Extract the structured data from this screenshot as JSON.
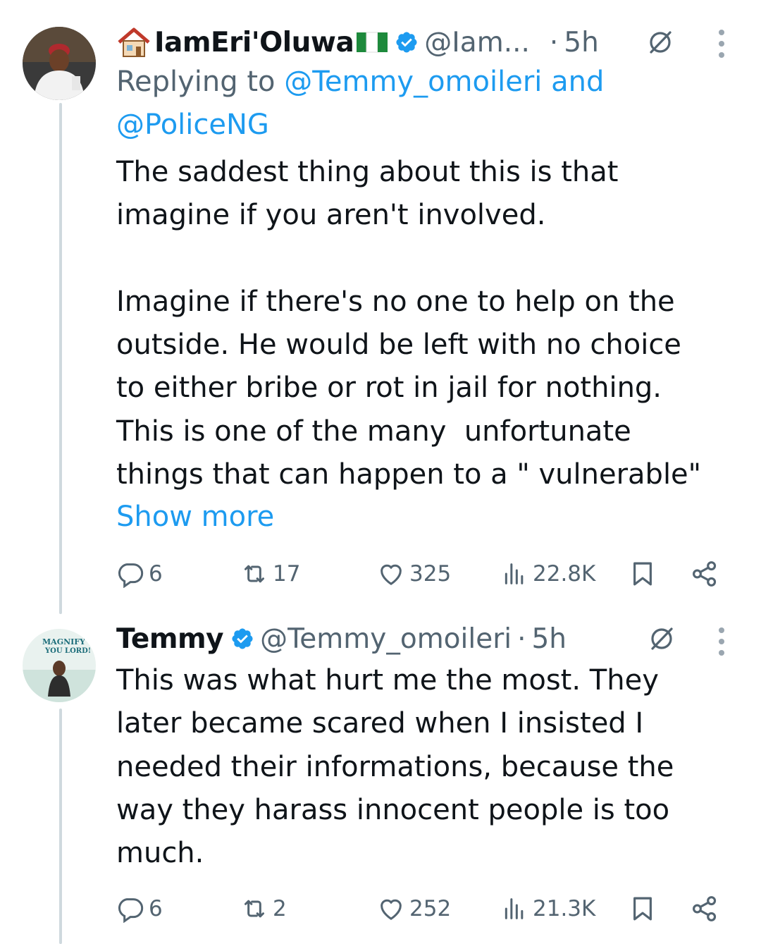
{
  "tweets": [
    {
      "emoji_prefix": "🏚",
      "name": "IamEri'Oluwa",
      "flag": "Nigeria flag",
      "handle": "@Iam...",
      "dot": "·",
      "time": "5h",
      "reply_prefix": "Replying to ",
      "reply_user1": "@Temmy_omoileri",
      "reply_and": " and",
      "reply_user2": "@PoliceNG",
      "text": "The saddest thing about this is that\nimagine if you aren't involved.\n\nImagine if there's no one to help on the\noutside. He would be left with no choice\nto either bribe or rot in jail for nothing.\nThis is one of the many  unfortunate\nthings that can happen to a \" vulnerable\"",
      "show_more": "Show more",
      "replies": "6",
      "reposts": "17",
      "likes": "325",
      "views": "22.8K"
    },
    {
      "name": "Temmy",
      "handle": "@Temmy_omoileri",
      "dot": "·",
      "time": "5h",
      "text": "This was what hurt me the most. They\nlater became scared when I insisted I\nneeded their informations, because the\nway they harass innocent people is too\nmuch.",
      "avatar_text_1": "MAGNIFY",
      "avatar_text_2": "YOU LORD!",
      "replies": "6",
      "reposts": "2",
      "likes": "252",
      "views": "21.3K"
    }
  ],
  "colors": {
    "accent": "#1d9bf0",
    "muted": "#536471",
    "text": "#0f1419",
    "thread": "#cfd9de"
  },
  "icons": [
    "reply-icon",
    "repost-icon",
    "like-icon",
    "views-icon",
    "bookmark-icon",
    "share-icon",
    "verified-icon",
    "grok-icon",
    "more-icon"
  ]
}
